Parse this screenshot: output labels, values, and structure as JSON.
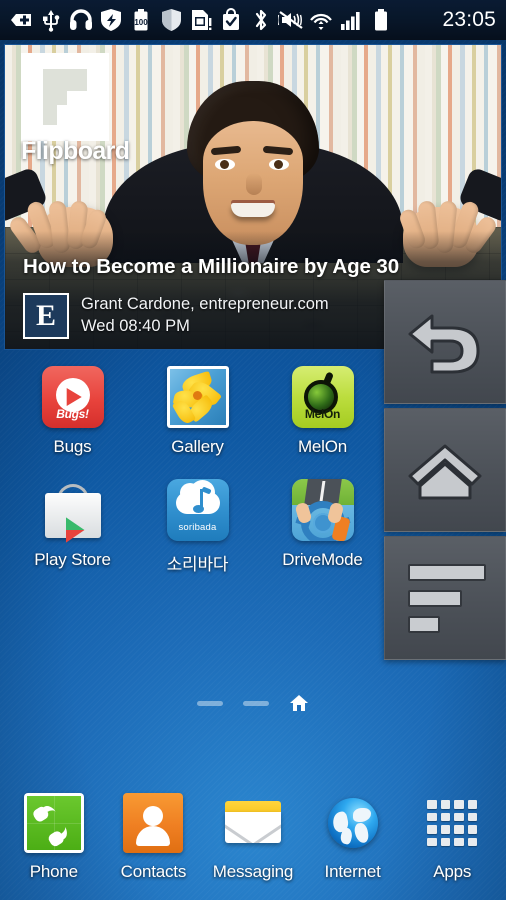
{
  "status_bar": {
    "time": "23:05",
    "icons": [
      {
        "name": "sd-card-plus-icon",
        "label": "memory card add"
      },
      {
        "name": "usb-icon",
        "label": "USB connected"
      },
      {
        "name": "headphones-icon",
        "label": "headset connected"
      },
      {
        "name": "shield-sync-icon",
        "label": "security sync"
      },
      {
        "name": "battery-100-icon",
        "label": "100"
      },
      {
        "name": "shield-icon",
        "label": "protection active"
      },
      {
        "name": "sim-alert-icon",
        "label": "SIM card alert"
      },
      {
        "name": "shopping-bag-check-icon",
        "label": "app installed"
      },
      {
        "name": "bluetooth-icon",
        "label": "Bluetooth on"
      },
      {
        "name": "mute-vibrate-icon",
        "label": "silent with vibrate"
      },
      {
        "name": "wifi-icon",
        "label": "Wi-Fi connected"
      },
      {
        "name": "signal-icon",
        "label": "cellular signal"
      },
      {
        "name": "battery-icon",
        "label": "battery full"
      }
    ]
  },
  "widget": {
    "brand": "Flipboard",
    "title": "How to Become a Millionaire by Age 30",
    "badge_letter": "E",
    "source": "Grant Cardone, entrepreneur.com",
    "date": "Wed 08:40 PM"
  },
  "floating_nav": [
    {
      "name": "back-button",
      "icon": "back-arrow-icon",
      "label": "Back"
    },
    {
      "name": "home-button",
      "icon": "home-icon",
      "label": "Home"
    },
    {
      "name": "menu-button",
      "icon": "menu-lines-icon",
      "label": "Menu"
    }
  ],
  "app_grid": {
    "rows": [
      [
        {
          "label": "Bugs",
          "icon": "bugs-app-icon",
          "icon_text": "Bugs!"
        },
        {
          "label": "Gallery",
          "icon": "gallery-app-icon",
          "icon_text": ""
        },
        {
          "label": "MelOn",
          "icon": "melon-app-icon",
          "icon_text": "MelOn"
        }
      ],
      [
        {
          "label": "Play Store",
          "icon": "play-store-app-icon",
          "icon_text": ""
        },
        {
          "label": "소리바다",
          "icon": "soribada-app-icon",
          "icon_text": "soribada"
        },
        {
          "label": "DriveMode",
          "icon": "drivemode-app-icon",
          "icon_text": ""
        }
      ]
    ]
  },
  "page_indicator": {
    "pages": [
      {
        "name": "page-dot-1",
        "type": "dash",
        "active": false
      },
      {
        "name": "page-dot-2",
        "type": "dash",
        "active": false
      },
      {
        "name": "page-dot-home",
        "type": "home",
        "active": true
      }
    ]
  },
  "dock": {
    "items": [
      {
        "label": "Phone",
        "icon": "phone-icon"
      },
      {
        "label": "Contacts",
        "icon": "contacts-icon"
      },
      {
        "label": "Messaging",
        "icon": "messaging-icon"
      },
      {
        "label": "Internet",
        "icon": "internet-globe-icon"
      },
      {
        "label": "Apps",
        "icon": "apps-grid-icon"
      }
    ]
  },
  "colors": {
    "wallpaper_blue": "#1d6cb8",
    "status_bar": "#081628",
    "nav_button": "#4c5158",
    "accent_white": "#ffffff"
  }
}
